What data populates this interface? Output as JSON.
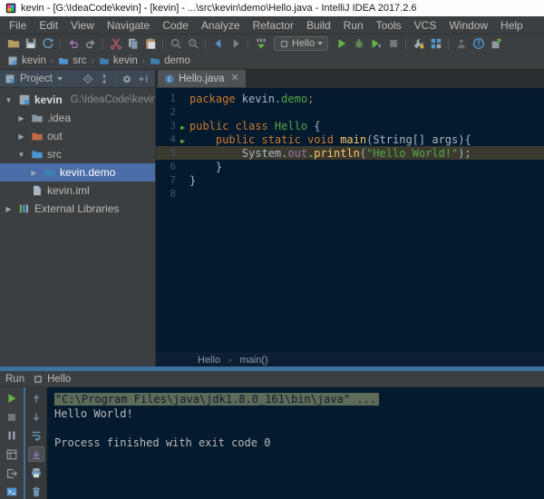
{
  "window": {
    "title": "kevin - [G:\\IdeaCode\\kevin] - [kevin] - ...\\src\\kevin\\demo\\Hello.java - IntelliJ IDEA 2017.2.6"
  },
  "menu": {
    "items": [
      "File",
      "Edit",
      "View",
      "Navigate",
      "Code",
      "Analyze",
      "Refactor",
      "Build",
      "Run",
      "Tools",
      "VCS",
      "Window",
      "Help"
    ]
  },
  "toolbar": {
    "groups_left": [
      [
        "open",
        "save",
        "sync"
      ],
      [
        "undo",
        "redo"
      ],
      [
        "cut",
        "copy",
        "paste"
      ],
      [
        "find",
        "replace"
      ],
      [
        "back",
        "forward"
      ],
      [
        "make"
      ]
    ],
    "run_config": "Hello",
    "groups_right": [
      [
        "run",
        "debug",
        "coverage",
        "stop"
      ],
      [
        "settings",
        "structure"
      ],
      [
        "ant",
        "help",
        "updates"
      ]
    ]
  },
  "navbar": {
    "crumbs": [
      {
        "label": "kevin",
        "icon": "project"
      },
      {
        "label": "src",
        "icon": "folder-src"
      },
      {
        "label": "kevin",
        "icon": "package"
      },
      {
        "label": "demo",
        "icon": "package"
      }
    ]
  },
  "project": {
    "header": "Project",
    "header_icons": [
      "locate",
      "collapse",
      "gear",
      "hide"
    ],
    "tree": [
      {
        "label": "kevin",
        "suffix": "G:\\IdeaCode\\kevin",
        "icon": "project",
        "arrow": "expanded",
        "indent": 0,
        "bold": true
      },
      {
        "label": ".idea",
        "icon": "folder",
        "arrow": "collapsed",
        "indent": 1
      },
      {
        "label": "out",
        "icon": "folder-excluded",
        "arrow": "collapsed",
        "indent": 1
      },
      {
        "label": "src",
        "icon": "folder-src",
        "arrow": "expanded",
        "indent": 1
      },
      {
        "label": "kevin.demo",
        "icon": "package",
        "arrow": "collapsed",
        "indent": 2,
        "selected": true
      },
      {
        "label": "kevin.iml",
        "icon": "file",
        "arrow": "none",
        "indent": 1
      },
      {
        "label": "External Libraries",
        "icon": "libraries",
        "arrow": "collapsed",
        "indent": 0
      }
    ]
  },
  "editor": {
    "tab": "Hello.java",
    "breadcrumbs": [
      "Hello",
      "main()"
    ],
    "lines": [
      {
        "n": 1,
        "tokens": [
          {
            "t": "package ",
            "c": "kw"
          },
          {
            "t": "kevin.",
            "c": "pl"
          },
          {
            "t": "demo",
            "c": "grn"
          },
          {
            "t": ";",
            "c": "kw"
          }
        ]
      },
      {
        "n": 2,
        "tokens": []
      },
      {
        "n": 3,
        "run": true,
        "tokens": [
          {
            "t": "public class ",
            "c": "kw"
          },
          {
            "t": "Hello ",
            "c": "grn"
          },
          {
            "t": "{",
            "c": "pl"
          }
        ]
      },
      {
        "n": 4,
        "run": true,
        "tokens": [
          {
            "t": "    ",
            "c": "pl"
          },
          {
            "t": "public static void ",
            "c": "kw"
          },
          {
            "t": "main",
            "c": "yel"
          },
          {
            "t": "(String[] args){",
            "c": "pl"
          }
        ]
      },
      {
        "n": 5,
        "hl": true,
        "tokens": [
          {
            "t": "        System.",
            "c": "pl"
          },
          {
            "t": "out",
            "c": "pur"
          },
          {
            "t": ".",
            "c": "pl"
          },
          {
            "t": "println",
            "c": "yel"
          },
          {
            "t": "(",
            "c": "pl"
          },
          {
            "t": "\"Hello World!\"",
            "c": "grn"
          },
          {
            "t": ");",
            "c": "pl"
          }
        ]
      },
      {
        "n": 6,
        "tokens": [
          {
            "t": "    }",
            "c": "pl"
          }
        ]
      },
      {
        "n": 7,
        "tokens": [
          {
            "t": "}",
            "c": "pl"
          }
        ]
      },
      {
        "n": 8,
        "tokens": []
      }
    ]
  },
  "run": {
    "label": "Run",
    "tab": "Hello",
    "toolbar1": [
      "rerun",
      "stop",
      "pause",
      "restore",
      "detach",
      "consoleb"
    ],
    "toolbar2": [
      "up",
      "down",
      "softwrap",
      "scrollend",
      "print",
      "clear"
    ],
    "console": [
      {
        "text": "\"C:\\Program Files\\java\\jdk1.8.0_161\\bin\\java\" ...",
        "selected": true
      },
      {
        "text": "Hello World!"
      },
      {
        "text": ""
      },
      {
        "text": "Process finished with exit code 0"
      }
    ]
  },
  "colors": {
    "editor_bg": "#041A2E",
    "panel_bg": "#3C3F41",
    "selection_blue": "#4A6DA8",
    "splitter_blue": "#3F719F",
    "keyword": "#CC7832",
    "string_green": "#57A64A",
    "method_yellow": "#FFC66D",
    "field_purple": "#9876AA",
    "run_green": "#62B543",
    "console_selection": "#5F6B5A"
  }
}
